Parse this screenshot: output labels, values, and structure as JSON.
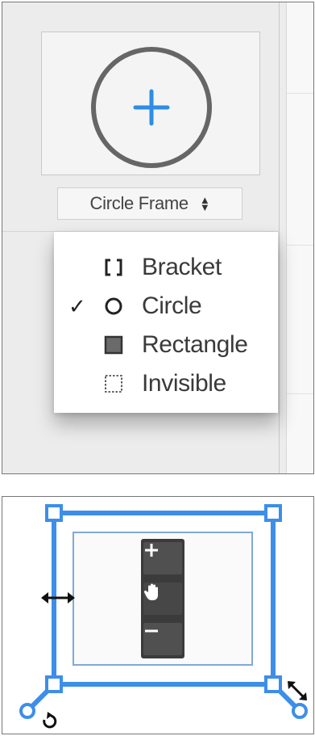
{
  "frame_selector": {
    "selected_label": "Circle Frame",
    "arrows_icon": "up-down-arrows-icon"
  },
  "menu": {
    "items": [
      {
        "label": "Bracket",
        "icon": "bracket-icon",
        "checked": false
      },
      {
        "label": "Circle",
        "icon": "circle-icon",
        "checked": true
      },
      {
        "label": "Rectangle",
        "icon": "rectangle-icon",
        "checked": false
      },
      {
        "label": "Invisible",
        "icon": "dashed-square-icon",
        "checked": false
      }
    ],
    "check_glyph": "✓"
  },
  "zoom_controls": {
    "zoom_in": "+",
    "zoom_out": "−"
  },
  "colors": {
    "accent_blue": "#3d8ee8",
    "frame_gray": "#666666",
    "zoom_bar": "#3b3b3b",
    "plus_blue": "#2e8de4"
  }
}
